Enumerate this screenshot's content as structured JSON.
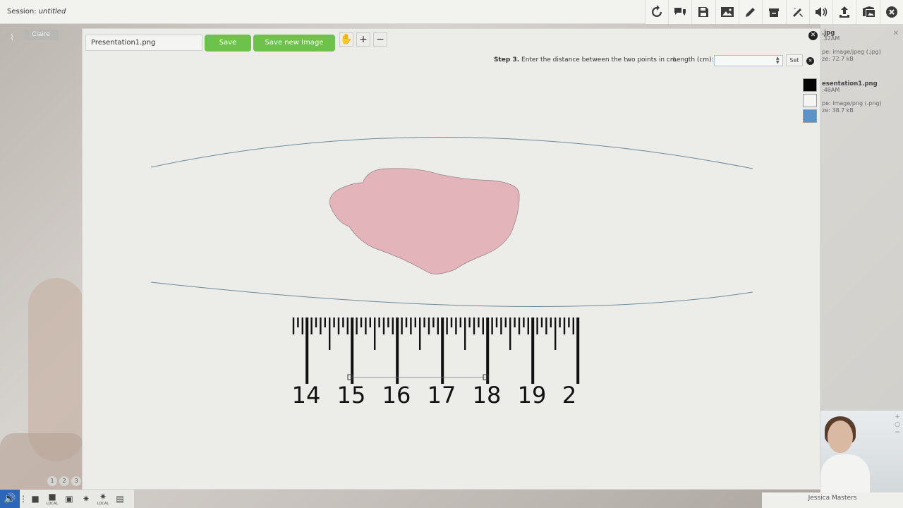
{
  "session": {
    "label": "Session:",
    "name": "untitled"
  },
  "toolbar_icons": [
    "refresh-icon",
    "chat-icon",
    "save-icon",
    "image-icon",
    "pencil-icon",
    "archive-icon",
    "tools-icon",
    "volume-icon",
    "upload-icon",
    "folder-image-icon",
    "close-icon"
  ],
  "participant": {
    "name": "Claire"
  },
  "editor": {
    "file_name": "Presentation1.png",
    "save_label": "Save",
    "save_new_label": "Save new Image",
    "step_label": "Step 3.",
    "step_text": " Enter the distance between the two points in cm",
    "length_label": "Length (cm):",
    "length_value": "",
    "set_label": "Set",
    "swatch_colors": [
      "#050505",
      "#f4f4f2",
      "#5b93c8"
    ]
  },
  "ruler": {
    "labels": [
      "14",
      "15",
      "16",
      "17",
      "18",
      "19",
      "2"
    ]
  },
  "files_panel": {
    "file1": {
      "name": ".jpg",
      "time": ".32AM",
      "type": "pe: image/jpeg (.jpg)",
      "size": "ze: 72.7 kB"
    },
    "file2": {
      "name": "esentation1.png",
      "time": ":48AM",
      "type": "pe: image/png (.png)",
      "size": "ze: 38.7 kB"
    }
  },
  "video": {
    "name": "Jessica Masters"
  },
  "pages": [
    "1",
    "2",
    "3"
  ],
  "bottom_controls": {
    "local_label_1": "LOCAL",
    "local_label_2": "LOCAL"
  },
  "colors": {
    "accent_green": "#6cc24a",
    "wound": "#e3b4b9",
    "ruler": "#111111"
  }
}
